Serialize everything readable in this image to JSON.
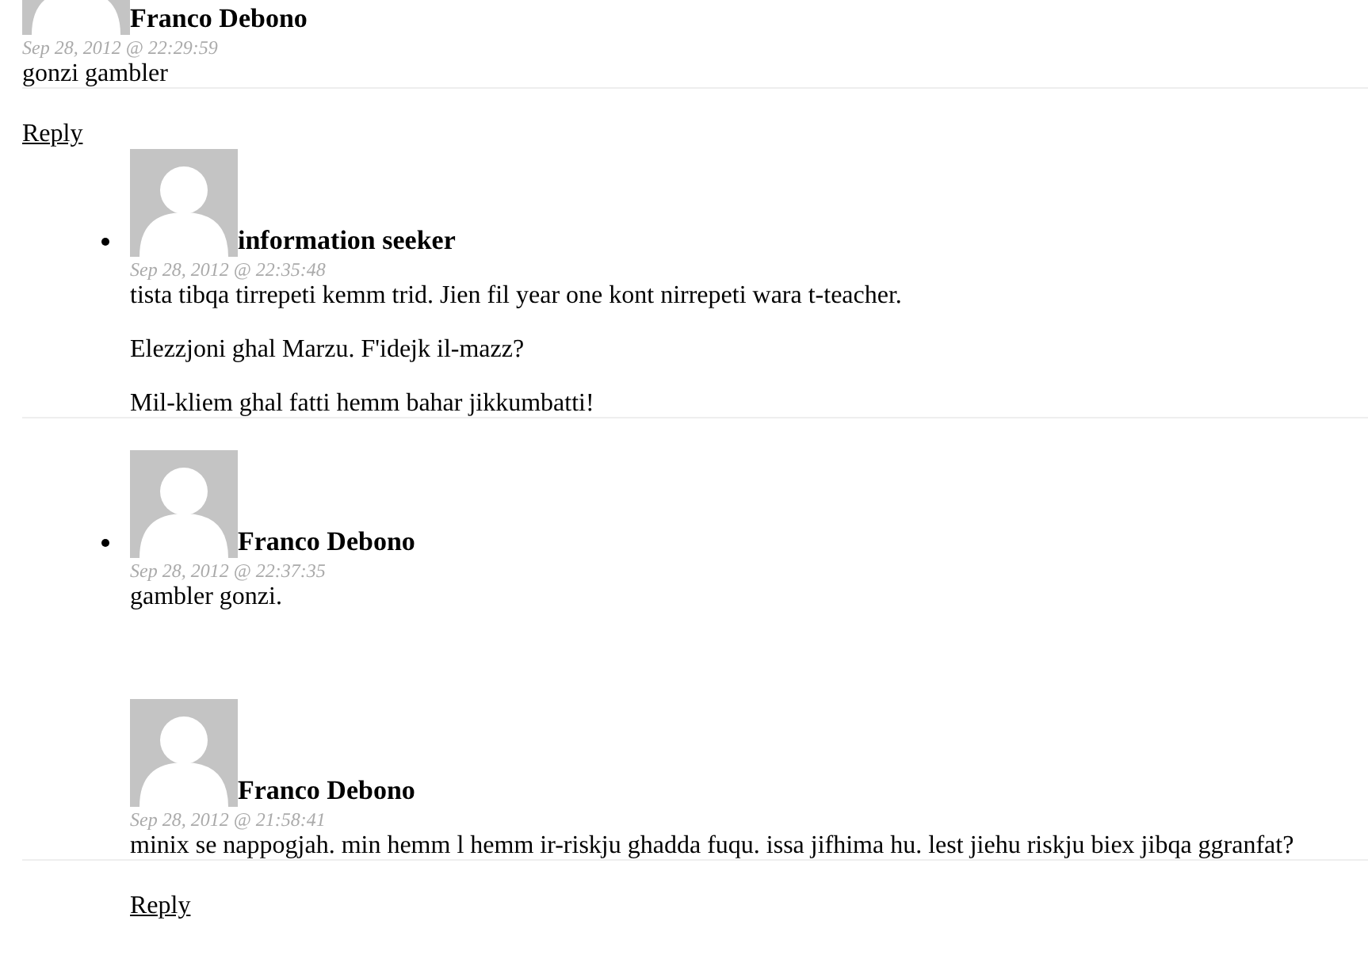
{
  "comments": [
    {
      "author": "Franco Debono",
      "date": "Sep 28, 2012 @ 22:29:59",
      "paragraphs": [
        "gonzi gambler"
      ],
      "bulleted": false,
      "divider": true,
      "reply": "Reply",
      "replies": [
        {
          "author": "information seeker",
          "date": "Sep 28, 2012 @ 22:35:48",
          "paragraphs": [
            "tista tibqa tirrepeti kemm trid. Jien fil year one kont nirrepeti wara t-teacher.",
            "Elezzjoni ghal Marzu. F'idejk il-mazz?",
            "Mil-kliem ghal fatti hemm bahar jikkumbatti!"
          ],
          "bulleted": true,
          "divider": true
        },
        {
          "author": "Franco Debono",
          "date": "Sep 28, 2012 @ 22:37:35",
          "paragraphs": [
            "gambler gonzi."
          ],
          "bulleted": true,
          "divider": false
        },
        {
          "author": "Franco Debono",
          "date": "Sep 28, 2012 @ 21:58:41",
          "paragraphs": [
            "minix se nappogjah. min hemm l hemm ir-riskju ghadda fuqu. issa jifhima hu. lest jiehu riskju biex jibqa ggranfat?"
          ],
          "bulleted": false,
          "divider": true,
          "reply": "Reply"
        }
      ]
    }
  ]
}
